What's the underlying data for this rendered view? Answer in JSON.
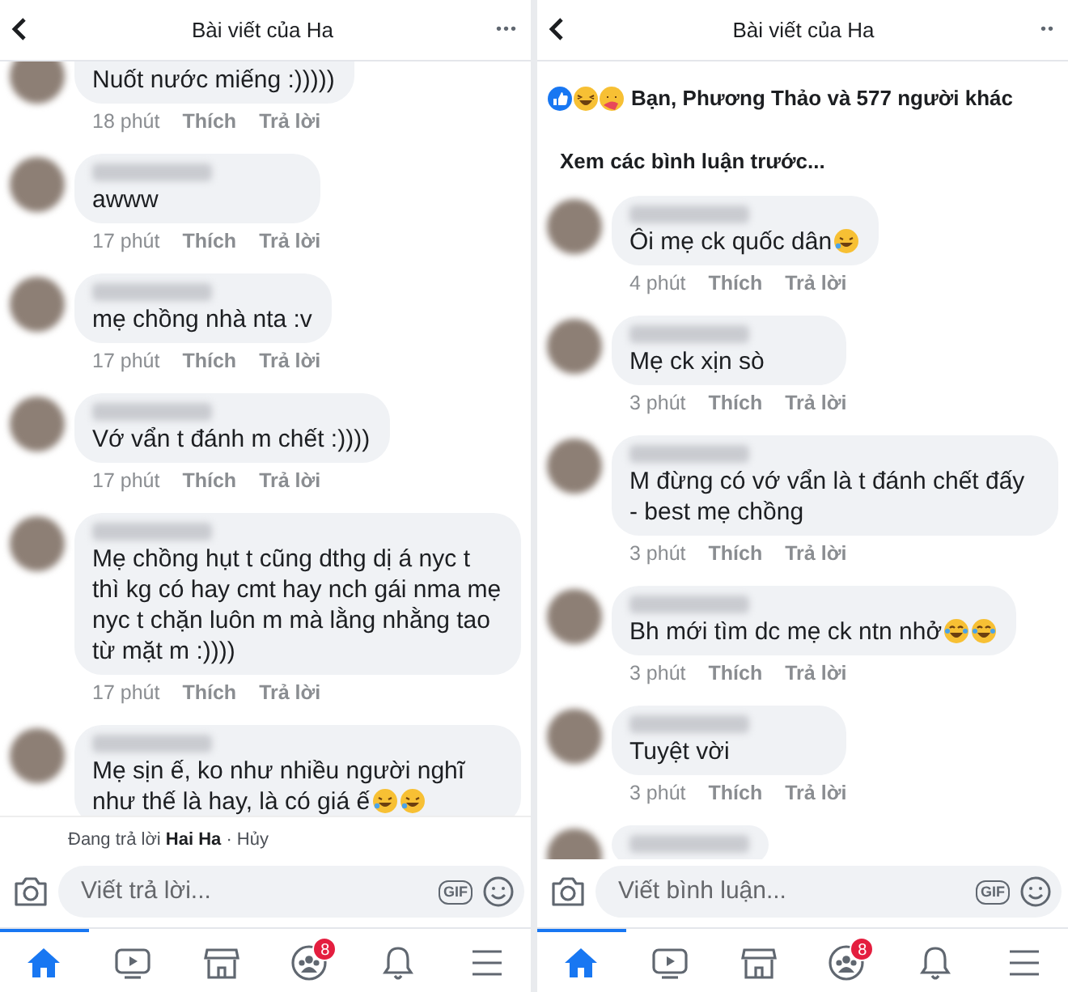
{
  "screens": [
    {
      "title": "Bài viết của Ha",
      "more": "•••",
      "comments": [
        {
          "kind": "cut",
          "text": "Nuốt nước miếng :)))))",
          "time": "18 phút",
          "like": "Thích",
          "reply": "Trả lời"
        },
        {
          "kind": "full",
          "text": "awww",
          "time": "17 phút",
          "like": "Thích",
          "reply": "Trả lời"
        },
        {
          "kind": "full",
          "text": "mẹ chồng nhà nta :v",
          "time": "17 phút",
          "like": "Thích",
          "reply": "Trả lời"
        },
        {
          "kind": "full",
          "text": "Vớ vẩn t đánh m chết :))))",
          "time": "17 phút",
          "like": "Thích",
          "reply": "Trả lời"
        },
        {
          "kind": "full",
          "text": "Mẹ chồng hụt t cũng dthg dị á nyc t thì kg có hay cmt hay nch gái nma mẹ nyc t chặn luôn m mà lằng nhằng tao từ mặt m :))))",
          "time": "17 phút",
          "like": "Thích",
          "reply": "Trả lời"
        },
        {
          "kind": "full",
          "text": "Mẹ sịn ế, ko như nhiều người nghĩ như thế là hay, là có giá ế",
          "emojis": [
            {
              "kind": "rofl"
            },
            {
              "kind": "rofl"
            }
          ]
        }
      ],
      "replying": {
        "prefix": "Đang trả lời",
        "name": "Hai Ha",
        "sep": "·",
        "cancel": "Hủy"
      },
      "composer": {
        "placeholder": "Viết trả lời...",
        "gif": "GIF"
      },
      "nav": [
        {
          "kind": "home",
          "selected": true
        },
        {
          "kind": "video",
          "selected": false
        },
        {
          "kind": "shop",
          "selected": false
        },
        {
          "kind": "groups",
          "selected": false,
          "badge": "8"
        },
        {
          "kind": "bell",
          "selected": false
        },
        {
          "kind": "menu",
          "selected": false
        }
      ]
    },
    {
      "title": "Bài viết của Ha",
      "more": "••",
      "reactions": "Bạn, Phương Thảo và 577 người khác",
      "previous": "Xem các bình luận trước...",
      "comments": [
        {
          "kind": "full",
          "text": "Ôi mẹ ck quốc dân",
          "emojis": [
            {
              "kind": "rofl"
            }
          ],
          "time": "4 phút",
          "like": "Thích",
          "reply": "Trả lời"
        },
        {
          "kind": "full",
          "text": "Mẹ ck xịn sò",
          "time": "3 phút",
          "like": "Thích",
          "reply": "Trả lời"
        },
        {
          "kind": "full",
          "text": "M đừng có vớ vẩn là t đánh chết đấy - best mẹ chồng",
          "time": "3 phút",
          "like": "Thích",
          "reply": "Trả lời"
        },
        {
          "kind": "full",
          "text": "Bh mới tìm dc mẹ ck ntn nhở",
          "emojis": [
            {
              "kind": "joy"
            },
            {
              "kind": "joy"
            }
          ],
          "time": "3 phút",
          "like": "Thích",
          "reply": "Trả lời"
        },
        {
          "kind": "full",
          "text": "Tuyệt vời",
          "time": "3 phút",
          "like": "Thích",
          "reply": "Trả lời"
        },
        {
          "kind": "full"
        }
      ],
      "composer": {
        "placeholder": "Viết bình luận...",
        "gif": "GIF"
      },
      "nav": [
        {
          "kind": "home",
          "selected": true
        },
        {
          "kind": "video",
          "selected": false
        },
        {
          "kind": "shop",
          "selected": false
        },
        {
          "kind": "groups",
          "selected": false,
          "badge": "8"
        },
        {
          "kind": "bell",
          "selected": false
        },
        {
          "kind": "menu",
          "selected": false
        }
      ]
    }
  ]
}
